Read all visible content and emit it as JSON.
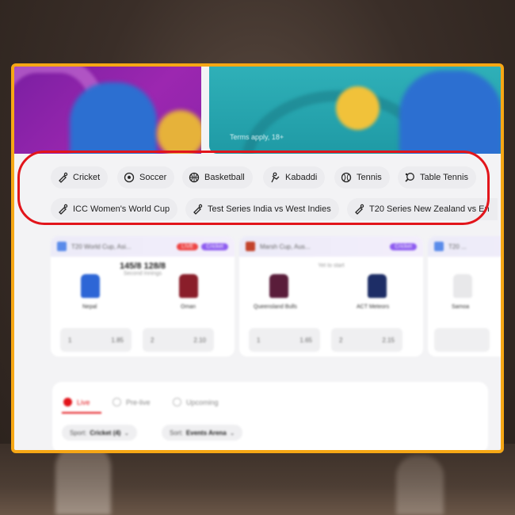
{
  "banner": {
    "terms": "Terms apply, 18+"
  },
  "sports": [
    {
      "label": "Cricket",
      "icon": "cricket-icon"
    },
    {
      "label": "Soccer",
      "icon": "soccer-icon"
    },
    {
      "label": "Basketball",
      "icon": "basketball-icon"
    },
    {
      "label": "Kabaddi",
      "icon": "kabaddi-icon"
    },
    {
      "label": "Tennis",
      "icon": "tennis-icon"
    },
    {
      "label": "Table Tennis",
      "icon": "table-tennis-icon"
    }
  ],
  "tournaments": [
    {
      "label": "ICC Women's World Cup",
      "icon": "cricket-icon"
    },
    {
      "label": "Test Series India vs West Indies",
      "icon": "cricket-icon"
    },
    {
      "label": "T20 Series New Zealand vs En",
      "icon": "cricket-icon"
    }
  ],
  "cards": [
    {
      "league": "T20 World Cup, Asi...",
      "badge_live": "LIVE",
      "badge_tag": "Cricket",
      "score": "145/8 128/8",
      "status": "Second Innings",
      "team1": "Nepal",
      "team2": "Oman",
      "odd1_label": "1",
      "odd1": "1.85",
      "odd2_label": "2",
      "odd2": "2.10"
    },
    {
      "league": "Marsh Cup, Aus...",
      "badge_tag": "Cricket",
      "score": "",
      "status": "Yet to start",
      "team1": "Queensland Bulls",
      "team2": "ACT Meteors",
      "odd1_label": "1",
      "odd1": "1.65",
      "odd2_label": "2",
      "odd2": "2.15"
    },
    {
      "league": "T20 ...",
      "team1": "Samoa"
    }
  ],
  "tabs": [
    {
      "label": "Live"
    },
    {
      "label": "Pre-live"
    },
    {
      "label": "Upcoming"
    }
  ],
  "filters": {
    "sport_label": "Sport:",
    "sport_value": "Cricket (4)",
    "sort_label": "Sort:",
    "sort_value": "Events Arena"
  },
  "colors": {
    "highlight": "#e2151b",
    "frame": "#f6a715",
    "accent_purple": "#8e5cf0"
  }
}
